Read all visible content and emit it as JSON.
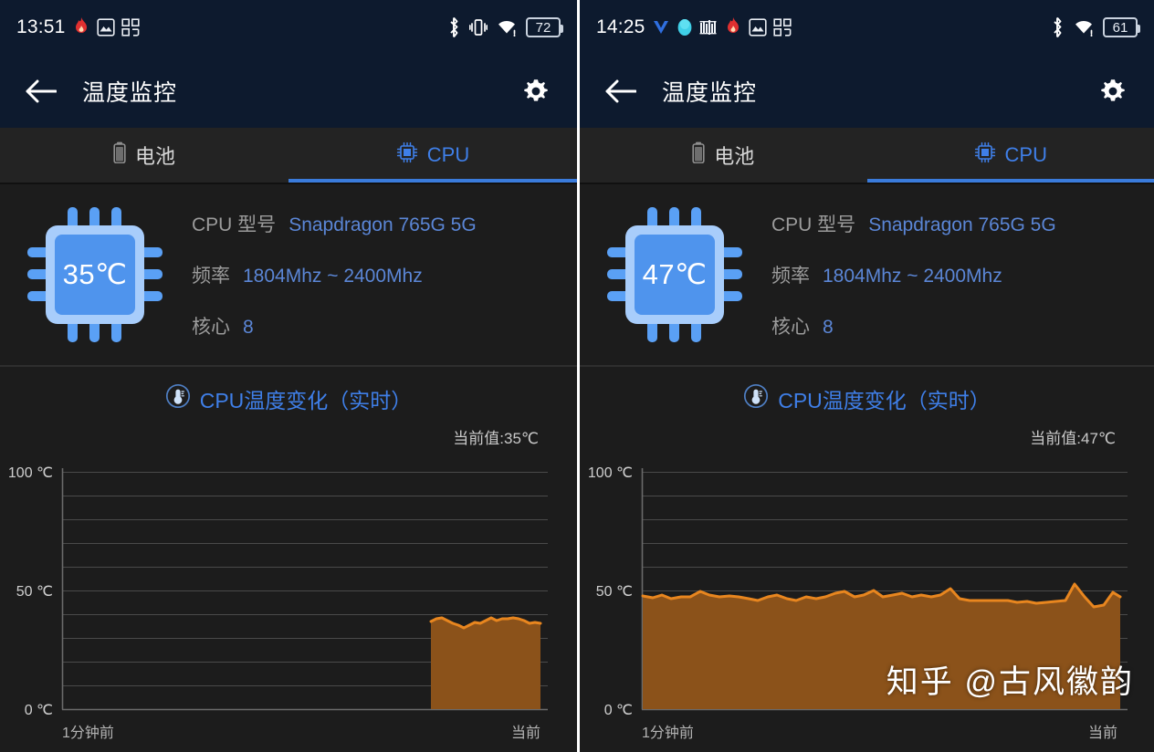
{
  "panels": [
    {
      "statusbar": {
        "clock": "13:51",
        "left_icons": [
          "flame-icon",
          "photo-icon",
          "qr-grid-icon"
        ],
        "right_icons": [
          "bluetooth-icon",
          "vibrate-icon",
          "wifi-icon"
        ],
        "battery": "72"
      },
      "appbar": {
        "back": "back-arrow-icon",
        "title": "温度监控",
        "settings": "gear-icon"
      },
      "tabs": [
        {
          "label": "电池",
          "icon": "battery-icon",
          "active": false
        },
        {
          "label": "CPU",
          "icon": "cpu-chip-icon",
          "active": true
        }
      ],
      "cpu": {
        "chip_temp": "35℃",
        "rows": [
          {
            "label": "CPU 型号",
            "value": "Snapdragon 765G 5G"
          },
          {
            "label": "频率",
            "value": "1804Mhz ~ 2400Mhz"
          },
          {
            "label": "核心",
            "value": "8"
          }
        ]
      },
      "chart": {
        "title": "CPU温度变化（实时）",
        "title_icon": "thermometer-icon",
        "current_label": "当前值:35℃",
        "x_left": "1分钟前",
        "x_right": "当前"
      },
      "watermark": ""
    },
    {
      "statusbar": {
        "clock": "14:25",
        "left_icons": [
          "v-logo-icon",
          "qq-penguin-icon",
          "music-bars-icon",
          "flame-icon",
          "photo-icon",
          "qr-grid-icon"
        ],
        "right_icons": [
          "bluetooth-icon",
          "wifi-icon"
        ],
        "battery": "61"
      },
      "appbar": {
        "back": "back-arrow-icon",
        "title": "温度监控",
        "settings": "gear-icon"
      },
      "tabs": [
        {
          "label": "电池",
          "icon": "battery-icon",
          "active": false
        },
        {
          "label": "CPU",
          "icon": "cpu-chip-icon",
          "active": true
        }
      ],
      "cpu": {
        "chip_temp": "47℃",
        "rows": [
          {
            "label": "CPU 型号",
            "value": "Snapdragon 765G 5G"
          },
          {
            "label": "频率",
            "value": "1804Mhz ~ 2400Mhz"
          },
          {
            "label": "核心",
            "value": "8"
          }
        ]
      },
      "chart": {
        "title": "CPU温度变化（实时）",
        "title_icon": "thermometer-icon",
        "current_label": "当前值:47℃",
        "x_left": "1分钟前",
        "x_right": "当前"
      },
      "watermark": "知乎 @古风徽韵"
    }
  ],
  "colors": {
    "accent_blue": "#3f7fe8",
    "status_bg": "#0d1a2e",
    "panel_bg": "#1c1c1c",
    "line_orange": "#e8861f",
    "fill_orange": "#8b521a",
    "label_grey": "#9b9b9b",
    "value_blue": "#5b86d6"
  },
  "chart_data": [
    {
      "type": "area",
      "title": "CPU温度变化（实时）",
      "xlabel": "",
      "ylabel": "℃",
      "ylim": [
        0,
        100
      ],
      "yticks": [
        0,
        50,
        100
      ],
      "ytick_labels": [
        "0 ℃",
        "50 ℃",
        "100 ℃"
      ],
      "gridlines": [
        10,
        20,
        30,
        40,
        50,
        60,
        70,
        80,
        90,
        100
      ],
      "grid": true,
      "legend": "none",
      "x_tick_labels": [
        "1分钟前",
        "当前"
      ],
      "annotation": "当前值:35℃",
      "current_value": 35,
      "series": [
        {
          "name": "CPU温度",
          "line_color": "#e8861f",
          "fill_color": "#8b521a",
          "x": [
            0.76,
            0.775,
            0.79,
            0.805,
            0.82,
            0.835,
            0.85,
            0.865,
            0.88,
            0.895,
            0.91,
            0.925,
            0.94,
            0.955,
            0.97,
            0.985,
            1.0
          ],
          "values": [
            37,
            37.5,
            36.5,
            36,
            35,
            34.5,
            35.5,
            36,
            35,
            34.5,
            35.5,
            36.5,
            35.5,
            36,
            36,
            36.5,
            35
          ]
        }
      ]
    },
    {
      "type": "area",
      "title": "CPU温度变化（实时）",
      "xlabel": "",
      "ylabel": "℃",
      "ylim": [
        0,
        100
      ],
      "yticks": [
        0,
        50,
        100
      ],
      "ytick_labels": [
        "0 ℃",
        "50 ℃",
        "100 ℃"
      ],
      "gridlines": [
        10,
        20,
        30,
        40,
        50,
        60,
        70,
        80,
        90,
        100
      ],
      "grid": true,
      "legend": "none",
      "x_tick_labels": [
        "1分钟前",
        "当前"
      ],
      "annotation": "当前值:47℃",
      "current_value": 47,
      "series": [
        {
          "name": "CPU温度",
          "line_color": "#e8861f",
          "fill_color": "#8b521a",
          "x": [
            0.0,
            0.02,
            0.04,
            0.06,
            0.08,
            0.1,
            0.12,
            0.14,
            0.16,
            0.18,
            0.2,
            0.22,
            0.24,
            0.26,
            0.28,
            0.3,
            0.32,
            0.34,
            0.36,
            0.38,
            0.4,
            0.42,
            0.44,
            0.46,
            0.48,
            0.5,
            0.52,
            0.54,
            0.56,
            0.58,
            0.6,
            0.62,
            0.64,
            0.66,
            0.68,
            0.7,
            0.72,
            0.74,
            0.76,
            0.78,
            0.8,
            0.82,
            0.84,
            0.86,
            0.88,
            0.9,
            0.92,
            0.94,
            0.96,
            0.98,
            1.0
          ],
          "values": [
            48,
            47,
            48,
            46.5,
            47,
            47,
            49,
            48,
            47,
            47.5,
            47,
            46.5,
            46,
            47,
            47.5,
            46.5,
            46,
            47,
            46.5,
            47,
            48,
            49,
            47,
            47.5,
            48.5,
            47,
            47.5,
            48,
            47,
            47.5,
            47,
            47.5,
            51,
            46.5,
            46,
            46,
            46,
            46,
            46,
            45,
            45.5,
            44.5,
            45,
            45.5,
            46,
            53,
            47,
            43,
            44,
            49.5,
            47
          ]
        }
      ]
    }
  ]
}
